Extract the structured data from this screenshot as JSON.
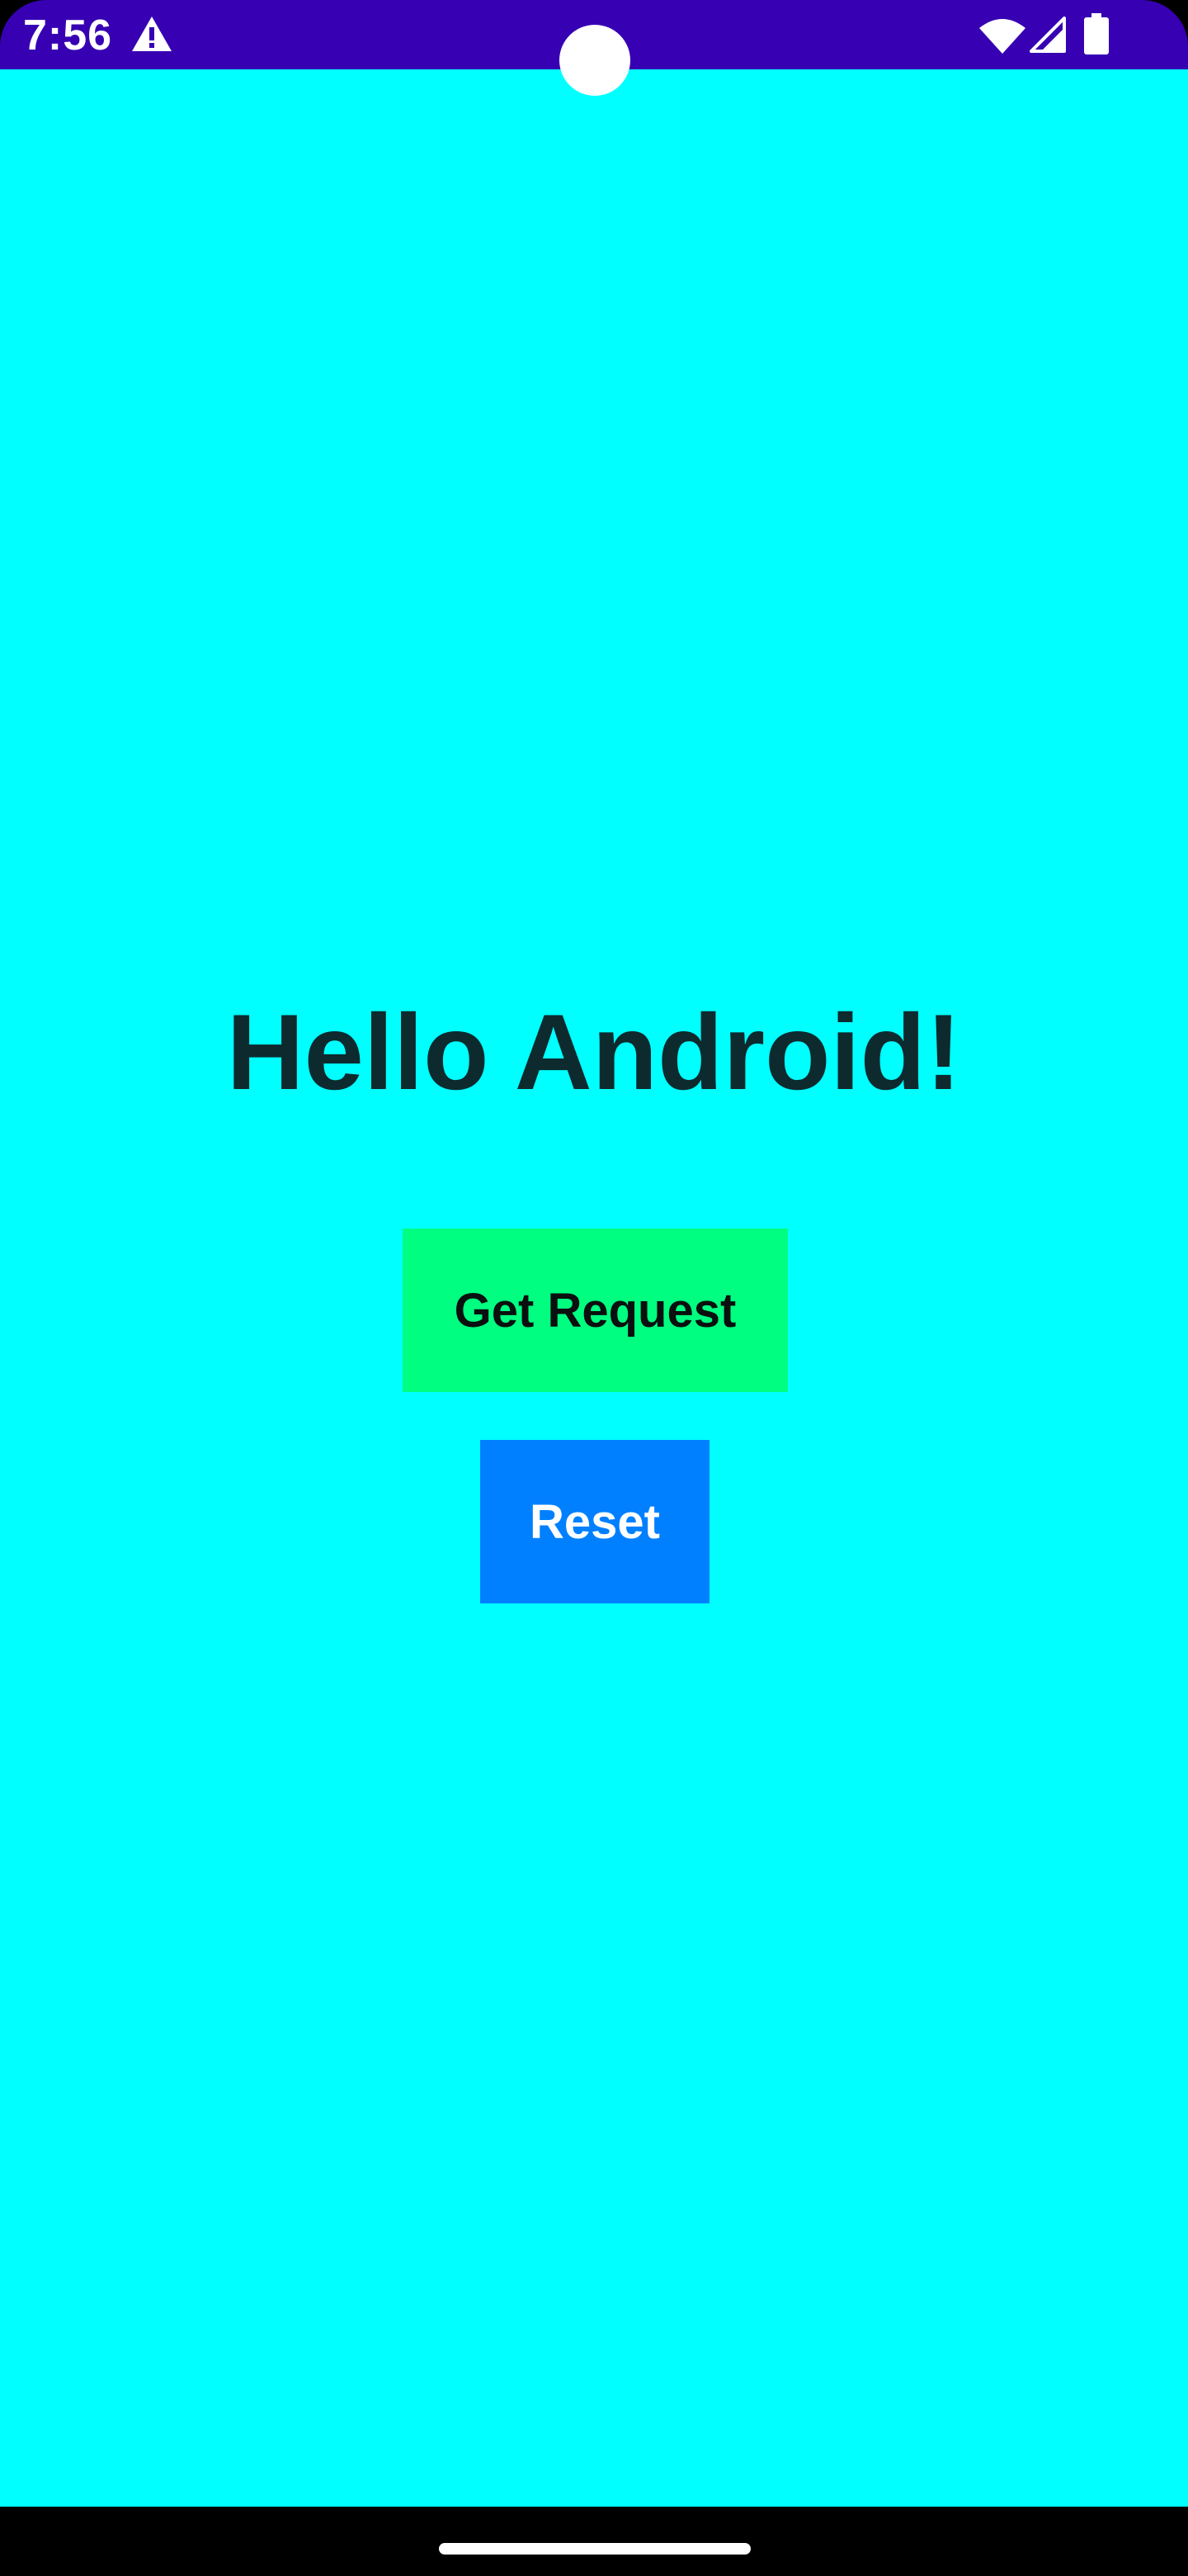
{
  "status_bar": {
    "time": "7:56",
    "icons": [
      "alert-icon",
      "wifi-icon",
      "cellular-signal-icon",
      "battery-icon"
    ]
  },
  "main": {
    "greeting": "Hello Android!",
    "get_request_label": "Get Request",
    "reset_label": "Reset"
  },
  "colors": {
    "status_bar": "#3700B3",
    "background": "#00FFFF",
    "greeting_text": "#0D2A2E",
    "get_request_button": "#00FF80",
    "reset_button": "#0080FF",
    "nav_bar": "#000000"
  }
}
